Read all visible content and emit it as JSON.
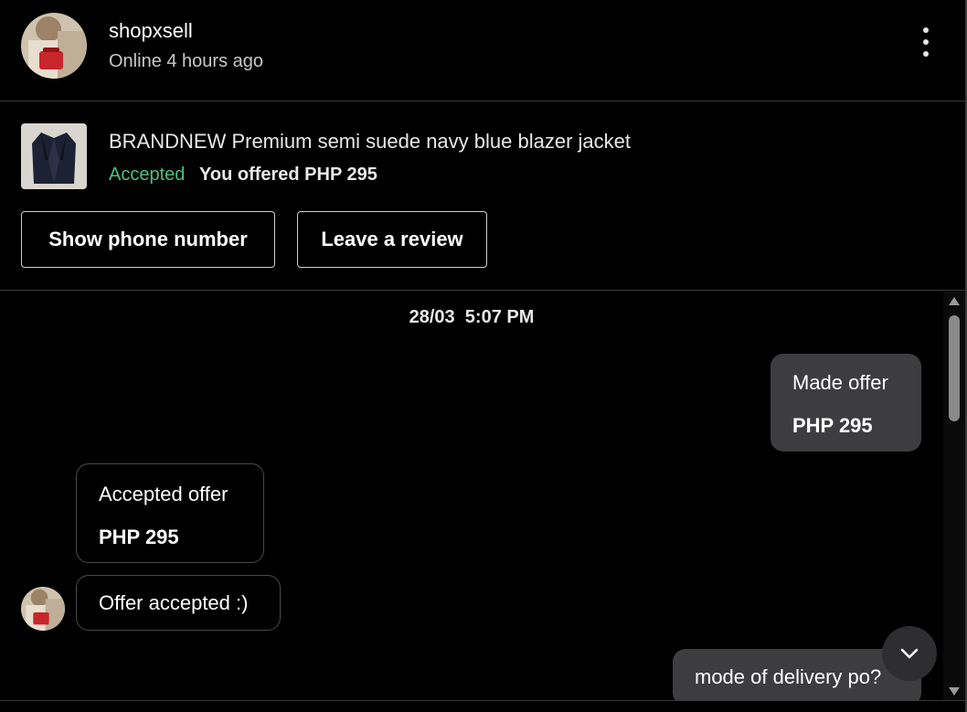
{
  "header": {
    "seller_name": "shopxsell",
    "status": "Online 4 hours ago",
    "avatar_icon": "seller-avatar",
    "more_icon": "vertical-dots-icon"
  },
  "listing": {
    "title": "BRANDNEW Premium semi suede navy blue blazer jacket",
    "status": "Accepted",
    "offer_text": "You offered PHP 295",
    "buttons": {
      "phone": "Show phone number",
      "review": "Leave a review"
    }
  },
  "chat": {
    "date": "28/03",
    "time": "5:07 PM",
    "messages": [
      {
        "direction": "out",
        "line1": "Made offer",
        "line2": "PHP 295"
      },
      {
        "direction": "in",
        "line1": "Accepted offer",
        "line2": "PHP 295"
      },
      {
        "direction": "in",
        "text": "Offer accepted :)"
      },
      {
        "direction": "out",
        "text": "mode of delivery po?"
      }
    ]
  },
  "colors": {
    "accepted": "#4cc17a",
    "bubble_out": "#3d3d3f",
    "background": "#000000"
  }
}
